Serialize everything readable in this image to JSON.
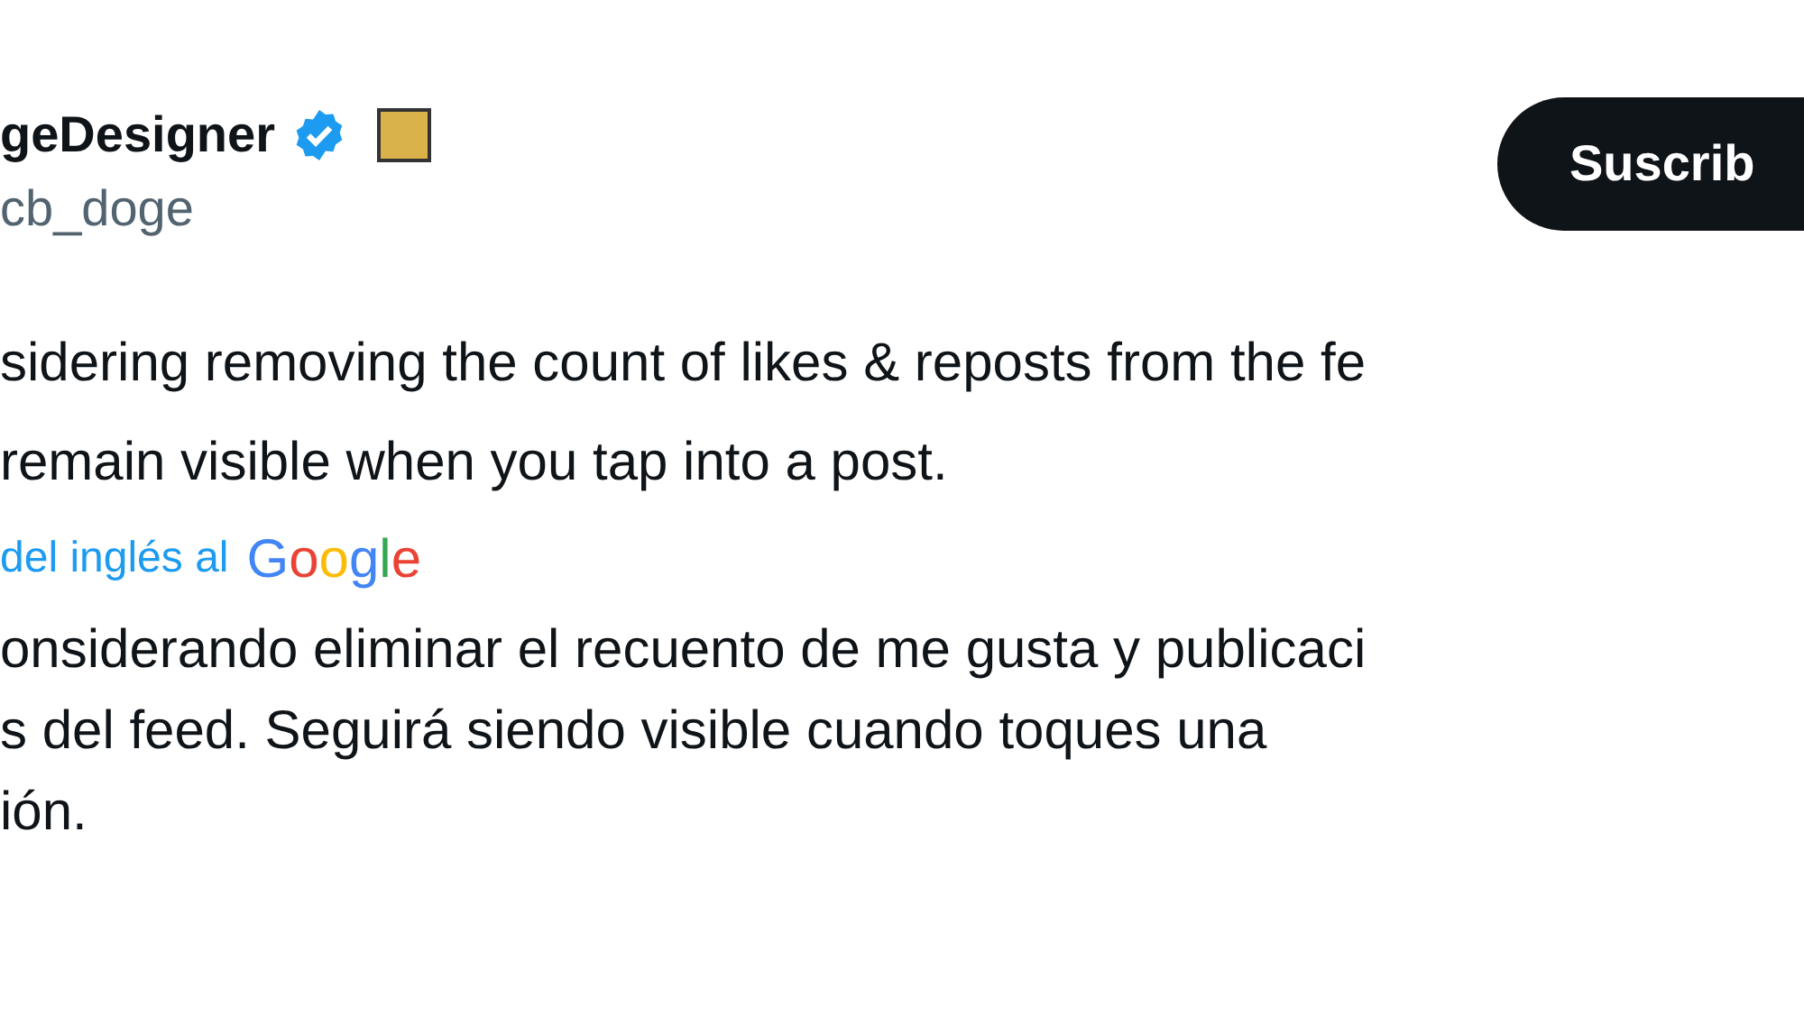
{
  "author": {
    "name": "geDesigner",
    "verified": true,
    "handle": "cb_doge"
  },
  "subscribe_button": "Suscrib",
  "post_lines": [
    "sidering removing the count of likes & reposts from the fe",
    "remain visible when you tap into a post."
  ],
  "translation_link": {
    "text": "del inglés al",
    "logo": "Google"
  },
  "translation_lines": [
    "onsiderando eliminar el recuento de me gusta y publicaci",
    "s del feed. Seguirá siendo visible cuando toques una",
    "ión."
  ]
}
